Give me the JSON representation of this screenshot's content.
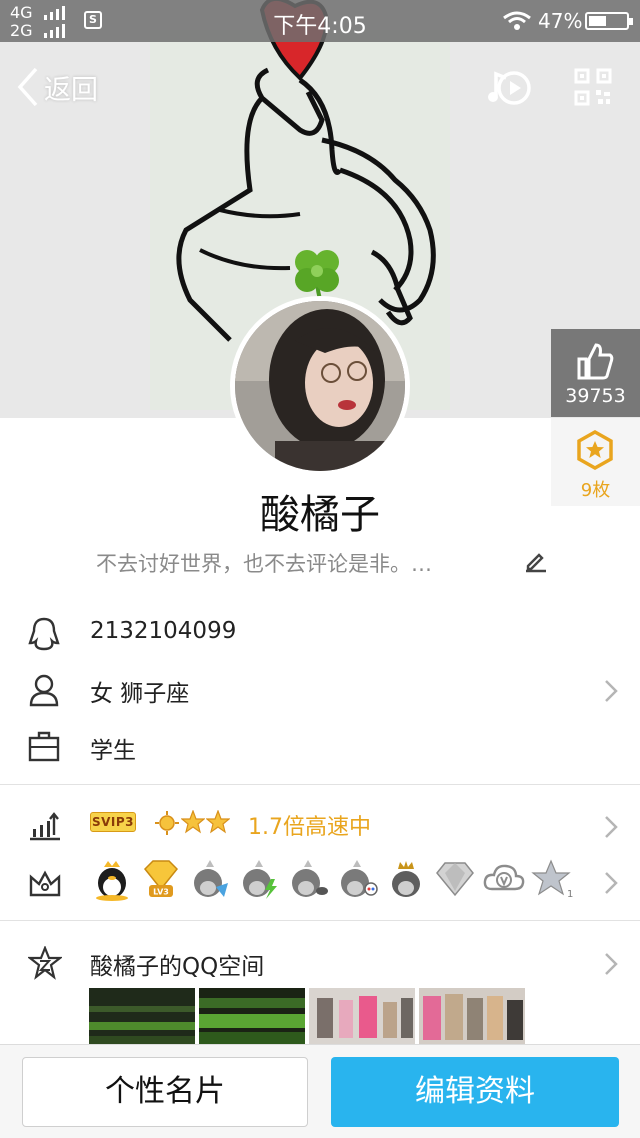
{
  "status_bar": {
    "network_1": "4G",
    "network_2": "2G",
    "s_badge": "S",
    "time": "下午4:05",
    "battery_pct": "47%",
    "battery_level": 0.47
  },
  "nav": {
    "back_label": "返回",
    "music_icon": "music-play-icon",
    "qr_icon": "qr-code-icon"
  },
  "like": {
    "count": "39753",
    "icon": "thumbs-up-icon"
  },
  "medal": {
    "count": "9枚",
    "icon": "medal-star-icon"
  },
  "profile": {
    "nickname": "酸橘子",
    "signature": "不去讨好世界，也不去评论是非。…"
  },
  "info": {
    "qq_number": "2132104099",
    "gender_zodiac": "女  狮子座",
    "occupation": "学生"
  },
  "vip": {
    "svip_label": "SVIP3",
    "speed_text": "1.7倍高速中"
  },
  "zone": {
    "title": "酸橘子的QQ空间"
  },
  "buttons": {
    "card": "个性名片",
    "edit": "编辑资料"
  },
  "colors": {
    "accent_blue": "#29b4ee",
    "gold": "#e9a51e",
    "status_bar": "#6e6e6e"
  }
}
